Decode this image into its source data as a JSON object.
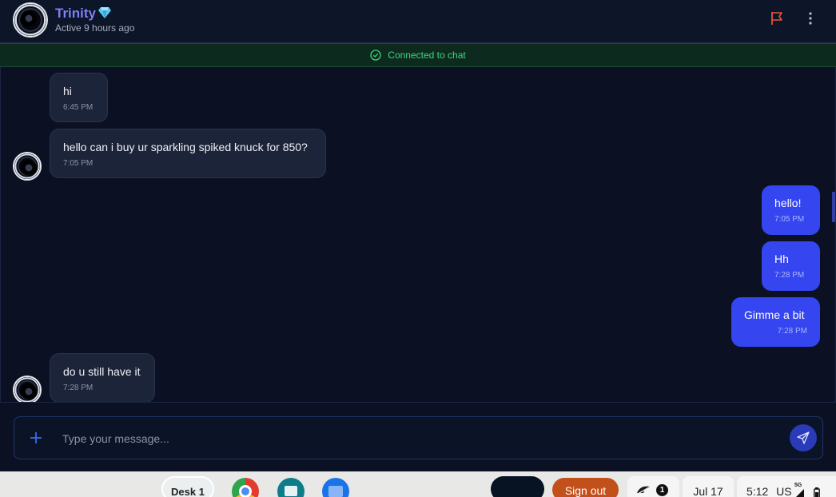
{
  "header": {
    "name": "Trinity",
    "status": "Active 9 hours ago",
    "badge_icon": "diamond-icon",
    "flag_icon": "flag-icon",
    "more_icon": "more-vertical-icon"
  },
  "banner": {
    "text": "Connected to chat",
    "icon": "check-circle-icon"
  },
  "messages": [
    {
      "direction": "in",
      "text": "hi",
      "time": "6:45 PM"
    },
    {
      "direction": "in",
      "text": "hello can i buy ur sparkling spiked knuck for 850?",
      "time": "7:05 PM"
    },
    {
      "direction": "out",
      "text": "hello!",
      "time": "7:05 PM"
    },
    {
      "direction": "out",
      "text": "Hh",
      "time": "7:28 PM"
    },
    {
      "direction": "out",
      "text": "Gimme a bit",
      "time": "7:28 PM"
    },
    {
      "direction": "in",
      "text": "do u still have it",
      "time": "7:28 PM"
    }
  ],
  "composer": {
    "placeholder": "Type your message...",
    "value": "",
    "attach_icon": "plus-icon",
    "send_icon": "send-icon"
  },
  "taskbar": {
    "desk_label": "Desk 1",
    "apps": [
      "chrome-icon",
      "news-icon",
      "files-icon"
    ],
    "sign_out": "Sign out",
    "notification_count": "1",
    "date": "Jul 17",
    "time": "5:12",
    "locale": "US",
    "network": "5G"
  },
  "colors": {
    "background": "#0b1122",
    "incoming_bubble": "#1c2439",
    "outgoing_bubble": "#3545f0",
    "name": "#7f7ff5",
    "connected": "#3ed67c",
    "flag": "#e5553d",
    "sign_out": "#c2501b"
  }
}
